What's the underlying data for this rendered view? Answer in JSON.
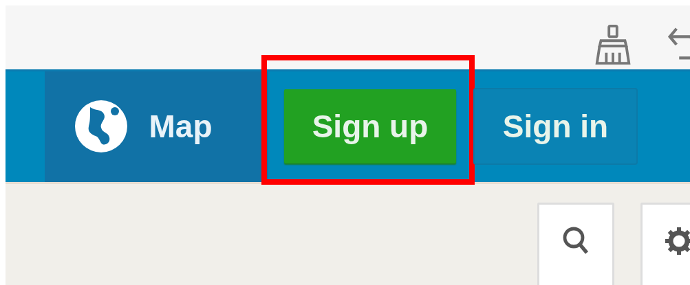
{
  "toolbar": {
    "tools": [
      {
        "kind": "clear"
      },
      {
        "kind": "undo"
      }
    ]
  },
  "nav": {
    "items": [
      {
        "label": "Map",
        "kind": "map",
        "highlighted": false
      },
      {
        "label": "Sign up",
        "kind": "primary",
        "highlighted": true
      },
      {
        "label": "Sign in",
        "kind": "secondary",
        "highlighted": false
      }
    ]
  },
  "controls": [
    {
      "kind": "search"
    },
    {
      "kind": "settings"
    }
  ]
}
